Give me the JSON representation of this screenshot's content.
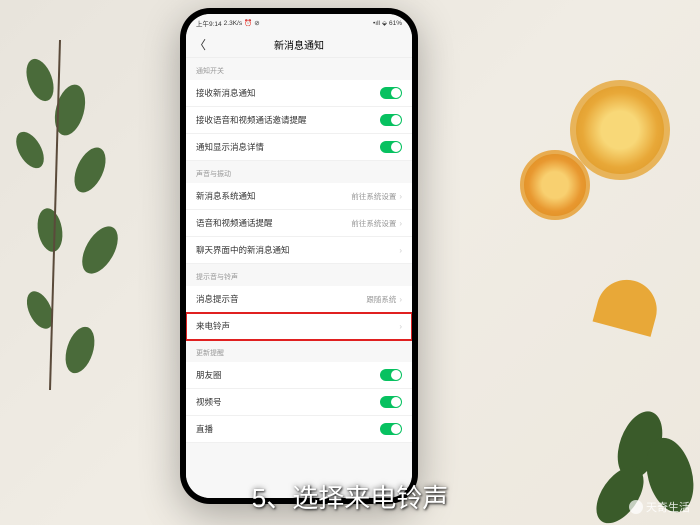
{
  "status": {
    "time": "上午9:14",
    "net": "2.3K/s",
    "alarm": "⏰",
    "extra": "⊘",
    "signal": "📶",
    "wifi": "📶",
    "battery": "61%"
  },
  "header": {
    "back": "〈",
    "title": "新消息通知"
  },
  "sections": [
    {
      "header": "通知开关",
      "rows": [
        {
          "label": "接收新消息通知",
          "type": "toggle",
          "on": true
        },
        {
          "label": "接收语音和视频通话邀请提醒",
          "type": "toggle",
          "on": true
        },
        {
          "label": "通知显示消息详情",
          "type": "toggle",
          "on": true
        }
      ]
    },
    {
      "header": "声音与振动",
      "rows": [
        {
          "label": "新消息系统通知",
          "type": "link",
          "value": "前往系统设置"
        },
        {
          "label": "语音和视频通话提醒",
          "type": "link",
          "value": "前往系统设置"
        },
        {
          "label": "聊天界面中的新消息通知",
          "type": "link",
          "value": ""
        }
      ]
    },
    {
      "header": "提示音与铃声",
      "rows": [
        {
          "label": "消息提示音",
          "type": "link",
          "value": "跟随系统"
        },
        {
          "label": "来电铃声",
          "type": "link",
          "value": "",
          "highlight": true
        }
      ]
    },
    {
      "header": "更新提醒",
      "rows": [
        {
          "label": "朋友圈",
          "type": "toggle",
          "on": true
        },
        {
          "label": "视频号",
          "type": "toggle",
          "on": true
        },
        {
          "label": "直播",
          "type": "toggle",
          "on": true
        }
      ]
    }
  ],
  "caption": "5、选择来电铃声",
  "watermark": "天奇生活"
}
